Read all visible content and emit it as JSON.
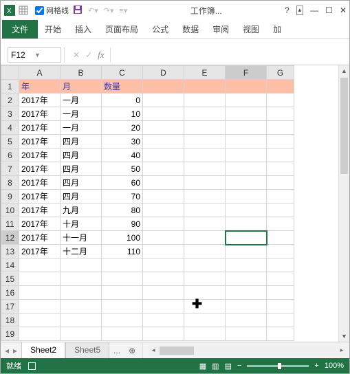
{
  "titlebar": {
    "gridlines_label": "网格线",
    "title": "工作簿...",
    "icons": {
      "save": "save-icon",
      "undo": "undo-icon",
      "redo": "redo-icon"
    }
  },
  "ribbon": {
    "file": "文件",
    "tabs": [
      "开始",
      "插入",
      "页面布局",
      "公式",
      "数据",
      "审阅",
      "视图",
      "加"
    ]
  },
  "formula": {
    "namebox": "F12",
    "fx": "fx",
    "value": ""
  },
  "grid": {
    "cols": [
      "A",
      "B",
      "C",
      "D",
      "E",
      "F",
      "G"
    ],
    "header": {
      "A": "年",
      "B": "月",
      "C": "数量"
    },
    "rows": [
      {
        "A": "2017年",
        "B": "一月",
        "C": 0
      },
      {
        "A": "2017年",
        "B": "一月",
        "C": 10
      },
      {
        "A": "2017年",
        "B": "一月",
        "C": 20
      },
      {
        "A": "2017年",
        "B": "四月",
        "C": 30
      },
      {
        "A": "2017年",
        "B": "四月",
        "C": 40
      },
      {
        "A": "2017年",
        "B": "四月",
        "C": 50
      },
      {
        "A": "2017年",
        "B": "四月",
        "C": 60
      },
      {
        "A": "2017年",
        "B": "四月",
        "C": 70
      },
      {
        "A": "2017年",
        "B": "九月",
        "C": 80
      },
      {
        "A": "2017年",
        "B": "十月",
        "C": 90
      },
      {
        "A": "2017年",
        "B": "十一月",
        "C": 100
      },
      {
        "A": "2017年",
        "B": "十二月",
        "C": 110
      }
    ],
    "blank_rows": 6,
    "selected_cell": "F12",
    "selected_row": 12
  },
  "sheets": {
    "tabs": [
      "Sheet2",
      "Sheet5"
    ],
    "active": 0,
    "add": "..."
  },
  "status": {
    "ready": "就绪",
    "zoom": "100%",
    "minus": "−",
    "plus": "+"
  }
}
